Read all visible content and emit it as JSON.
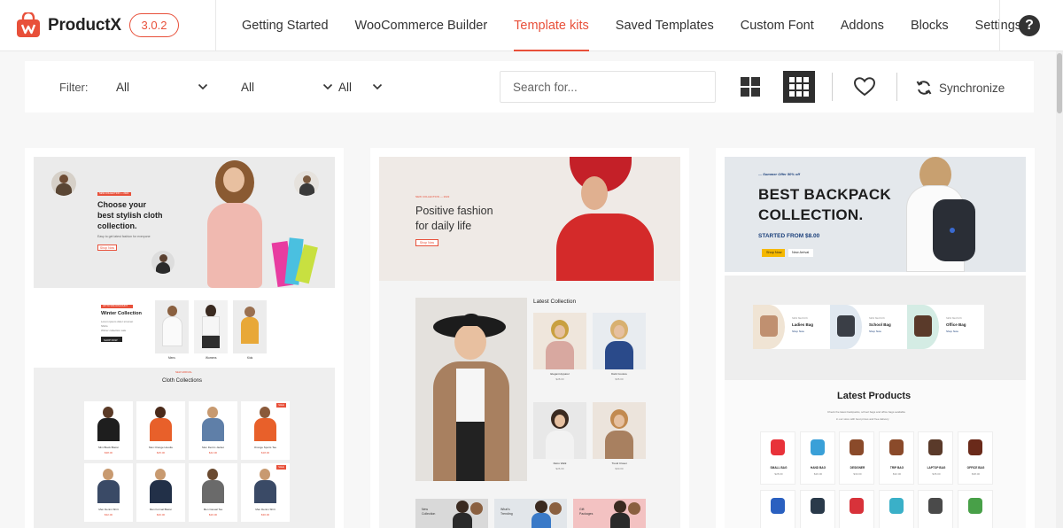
{
  "header": {
    "brand": "ProductX",
    "version": "3.0.2",
    "nav": [
      {
        "label": "Getting Started",
        "active": false
      },
      {
        "label": "WooCommerce Builder",
        "active": false
      },
      {
        "label": "Template kits",
        "active": true
      },
      {
        "label": "Saved Templates",
        "active": false
      },
      {
        "label": "Custom Font",
        "active": false
      },
      {
        "label": "Addons",
        "active": false
      },
      {
        "label": "Blocks",
        "active": false
      },
      {
        "label": "Settings",
        "active": false
      }
    ],
    "help_label": "?"
  },
  "colors": {
    "accent": "#e8503a",
    "dark": "#2e2e2e",
    "backpack_blue": "#1a3f7a"
  },
  "filter": {
    "label": "Filter:",
    "selects": [
      "All",
      "All",
      "All"
    ],
    "search_placeholder": "Search for...",
    "sync_label": "Synchronize"
  },
  "cards": {
    "fashion": {
      "hero_tag": "NEW COLLECTION — 2022",
      "hero_title_1": "Choose your",
      "hero_title_2": "best stylish cloth",
      "hero_title_3": "collection.",
      "hero_sub": "Easy to get latest fashion for everyone",
      "hero_btn": "Shop Now",
      "winter_tag": "UP TO 50% DISCOUNT",
      "winter_title": "Winter Collection",
      "winter_desc_1": "Lorem ipsum dolor sit amet",
      "winter_desc_2": "Shirts",
      "winter_desc_3": "Winter collection sale",
      "winter_btn": "SHOP NOW",
      "cat_1": "Mens",
      "cat_2": "Womens",
      "cat_3": "Kids",
      "sect_tag": "NEW ARRIVAL",
      "sect_title": "Cloth Collections",
      "products": [
        {
          "name": "Slim Black Blazer",
          "price": "$38.00"
        },
        {
          "name": "Men Orange Hoodie",
          "price": "$25.00"
        },
        {
          "name": "Men Denim Jacket",
          "price": "$42.00"
        },
        {
          "name": "Orange Sports Tee",
          "price": "$18.00"
        },
        {
          "name": "Men Denim Shirt",
          "price": "$32.00"
        },
        {
          "name": "Men Formal Blazer",
          "price": "$40.00"
        },
        {
          "name": "Men Casual Tee",
          "price": "$20.00"
        },
        {
          "name": "Men Denim Shirt",
          "price": "$30.00"
        }
      ],
      "sale_badge": "SALE"
    },
    "positive": {
      "hero_tag": "NEW COLLECTION — 2022",
      "hero_title_1": "Positive fashion",
      "hero_title_2": "for daily life",
      "hero_btn": "Shop Now",
      "latest_title": "Latest Collection",
      "items": [
        {
          "name": "Elegant Apparel",
          "price": "$28.00"
        },
        {
          "name": "Dark Couture",
          "price": "$35.00"
        },
        {
          "name": "Retro Walk",
          "price": "$26.00"
        },
        {
          "name": "Trend Closet",
          "price": "$30.00"
        }
      ],
      "banners": [
        {
          "l1": "New",
          "l2": "Collection"
        },
        {
          "l1": "What's",
          "l2": "Trending"
        },
        {
          "l1": "Gift",
          "l2": "Packages"
        }
      ]
    },
    "backpack": {
      "hero_tag": "— Summer Offer 50% off",
      "hero_title_1": "BEST BACKPACK",
      "hero_title_2": "COLLECTION.",
      "hero_price": "STARTED FROM $8.00",
      "btn_shop": "Shop Now",
      "btn_new": "New Arrival",
      "cats": [
        {
          "tag": "NEW SEASON",
          "name": "Ladies Bag",
          "link": "Shop Now"
        },
        {
          "tag": "NEW SEASON",
          "name": "School Bag",
          "link": "Shop Now"
        },
        {
          "tag": "NEW SEASON",
          "name": "Office Bag",
          "link": "Shop Now"
        }
      ],
      "latest_title": "Latest Products",
      "latest_desc_1": "Check the latest backpacks, school bags and office bags available",
      "latest_desc_2": "in our store with best prices and free delivery",
      "products": [
        {
          "name": "SMALL BAG",
          "price": "$28.00"
        },
        {
          "name": "HAND BAG",
          "price": "$26.00"
        },
        {
          "name": "DESIGNER",
          "price": "$30.00"
        },
        {
          "name": "TRIP BAG",
          "price": "$32.00"
        },
        {
          "name": "LAPTOP BAG",
          "price": "$35.00"
        },
        {
          "name": "OFFICE BAG",
          "price": "$38.00"
        }
      ]
    }
  }
}
